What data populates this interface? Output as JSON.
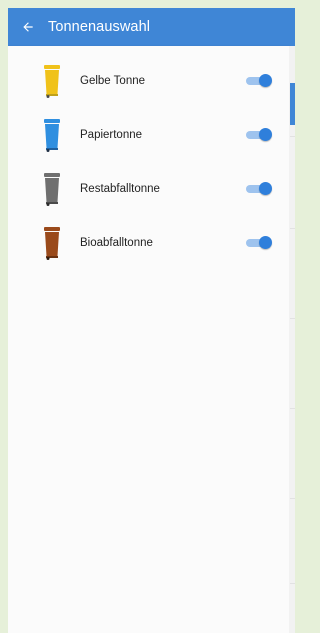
{
  "appbar": {
    "title": "Tonnenauswahl",
    "back_icon": "arrow-left-icon",
    "color": "#3f86d6"
  },
  "bins": [
    {
      "label": "Gelbe Tonne",
      "icon": "yellow-bin-icon",
      "color": "#f0c21a",
      "enabled": true
    },
    {
      "label": "Papiertonne",
      "icon": "blue-bin-icon",
      "color": "#2f8fe0",
      "enabled": true
    },
    {
      "label": "Restabfalltonne",
      "icon": "gray-bin-icon",
      "color": "#6f6f6f",
      "enabled": true
    },
    {
      "label": "Bioabfalltonne",
      "icon": "brown-bin-icon",
      "color": "#9a4a1b",
      "enabled": true
    }
  ],
  "toggle_color": "#2f7fdb"
}
